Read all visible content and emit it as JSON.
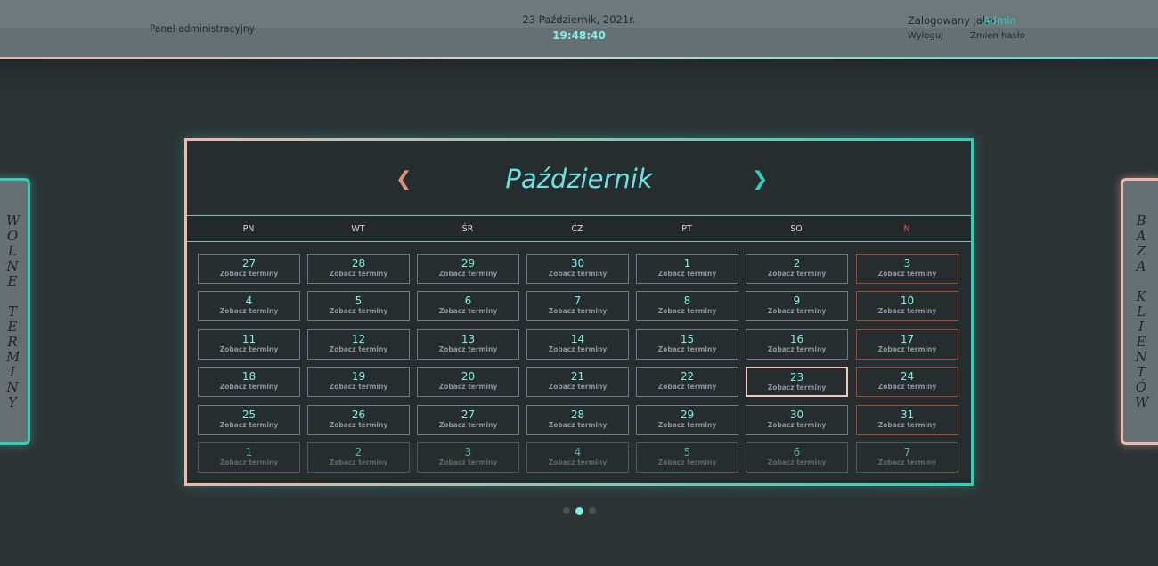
{
  "header": {
    "panel_title": "Panel administracyjny",
    "date": "23 Październik, 2021r.",
    "time": "19:48:40",
    "logged_label": "Zalogowany jako:",
    "logged_user": "Admin",
    "logout": "Wyloguj",
    "change_password": "Zmien hasło"
  },
  "side_left": {
    "label": "WOLNE TERMINY"
  },
  "side_right": {
    "label": "BAZA KLIENTÓW"
  },
  "calendar": {
    "month": "Październik",
    "weekdays": [
      "PN",
      "WT",
      "ŚR",
      "CZ",
      "PT",
      "SO",
      "N"
    ],
    "link_label": "Zobacz terminy",
    "weeks": [
      [
        "27",
        "28",
        "29",
        "30",
        "1",
        "2",
        "3"
      ],
      [
        "4",
        "5",
        "6",
        "7",
        "8",
        "9",
        "10"
      ],
      [
        "11",
        "12",
        "13",
        "14",
        "15",
        "16",
        "17"
      ],
      [
        "18",
        "19",
        "20",
        "21",
        "22",
        "23",
        "24"
      ],
      [
        "25",
        "26",
        "27",
        "28",
        "29",
        "30",
        "31"
      ],
      [
        "1",
        "2",
        "3",
        "4",
        "5",
        "6",
        "7"
      ]
    ],
    "today": "23"
  },
  "colors": {
    "accent": "#7ff0e6",
    "teal": "#2fcfb8",
    "peach": "#f0b7aa",
    "sunday": "#e45b52"
  },
  "pager": {
    "pages": 3,
    "active_page": 2
  },
  "icons": {
    "prev": "chevron-left-icon",
    "next": "chevron-right-icon"
  }
}
